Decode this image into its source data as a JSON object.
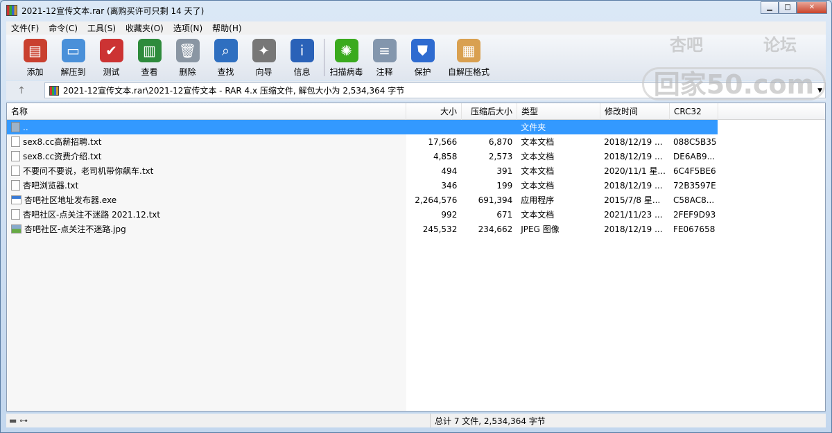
{
  "window": {
    "title": "2021-12宣传文本.rar (离购买许可只剩 14 天了)",
    "minimize": "▁",
    "maximize": "□",
    "close": "✕"
  },
  "menu": [
    "文件(F)",
    "命令(C)",
    "工具(S)",
    "收藏夹(O)",
    "选项(N)",
    "帮助(H)"
  ],
  "toolbar": [
    {
      "label": "添加",
      "icon": "add-archive-icon",
      "color": "#c9402f",
      "glyph": "▤"
    },
    {
      "label": "解压到",
      "icon": "extract-folder-icon",
      "color": "#4a90d9",
      "glyph": "▭"
    },
    {
      "label": "测试",
      "icon": "test-clipboard-icon",
      "color": "#c33",
      "glyph": "✔"
    },
    {
      "label": "查看",
      "icon": "view-book-icon",
      "color": "#2e8b3c",
      "glyph": "▥"
    },
    {
      "label": "删除",
      "icon": "trash-icon",
      "color": "#8a96a3",
      "glyph": "🗑"
    },
    {
      "label": "查找",
      "icon": "search-icon",
      "color": "#2f6fc0",
      "glyph": "⌕"
    },
    {
      "label": "向导",
      "icon": "wizard-wand-icon",
      "color": "#777",
      "glyph": "✦"
    },
    {
      "label": "信息",
      "icon": "info-icon",
      "color": "#2a62b8",
      "glyph": "i"
    },
    {
      "label": "扫描病毒",
      "icon": "virus-scan-icon",
      "color": "#3aaa1e",
      "glyph": "✺"
    },
    {
      "label": "注释",
      "icon": "comment-icon",
      "color": "#8396ad",
      "glyph": "≡"
    },
    {
      "label": "保护",
      "icon": "shield-icon",
      "color": "#2e6bd0",
      "glyph": "⛊"
    },
    {
      "label": "自解压格式",
      "icon": "sfx-box-icon",
      "color": "#d9a050",
      "glyph": "▦"
    }
  ],
  "address": {
    "path": "2021-12宣传文本.rar\\2021-12宣传文本 - RAR 4.x 压缩文件, 解包大小为 2,534,364 字节"
  },
  "watermark": {
    "line1a": "杏吧",
    "line1b": "论坛",
    "line2": "回家50.com"
  },
  "columns": [
    "名称",
    "大小",
    "压缩后大小",
    "类型",
    "修改时间",
    "CRC32"
  ],
  "files": [
    {
      "name": "..",
      "size": "",
      "packed": "",
      "type": "文件夹",
      "modified": "",
      "crc": "",
      "kind": "folder"
    },
    {
      "name": "sex8.cc高薪招聘.txt",
      "size": "17,566",
      "packed": "6,870",
      "type": "文本文档",
      "modified": "2018/12/19 ...",
      "crc": "088C5B35",
      "kind": "txt"
    },
    {
      "name": "sex8.cc资费介绍.txt",
      "size": "4,858",
      "packed": "2,573",
      "type": "文本文档",
      "modified": "2018/12/19 ...",
      "crc": "DE6AB9...",
      "kind": "txt"
    },
    {
      "name": "不要问不要说，老司机带你飙车.txt",
      "size": "494",
      "packed": "391",
      "type": "文本文档",
      "modified": "2020/11/1 星...",
      "crc": "6C4F5BE6",
      "kind": "txt"
    },
    {
      "name": "杏吧浏览器.txt",
      "size": "346",
      "packed": "199",
      "type": "文本文档",
      "modified": "2018/12/19 ...",
      "crc": "72B3597E",
      "kind": "txt"
    },
    {
      "name": "杏吧社区地址发布器.exe",
      "size": "2,264,576",
      "packed": "691,394",
      "type": "应用程序",
      "modified": "2015/7/8 星...",
      "crc": "C58AC8...",
      "kind": "exe"
    },
    {
      "name": "杏吧社区-点关注不迷路 2021.12.txt",
      "size": "992",
      "packed": "671",
      "type": "文本文档",
      "modified": "2021/11/23 ...",
      "crc": "2FEF9D93",
      "kind": "txt"
    },
    {
      "name": "杏吧社区-点关注不迷路.jpg",
      "size": "245,532",
      "packed": "234,662",
      "type": "JPEG 图像",
      "modified": "2018/12/19 ...",
      "crc": "FE067658",
      "kind": "jpg"
    }
  ],
  "status": {
    "total": "总计 7 文件, 2,534,364 字节"
  }
}
